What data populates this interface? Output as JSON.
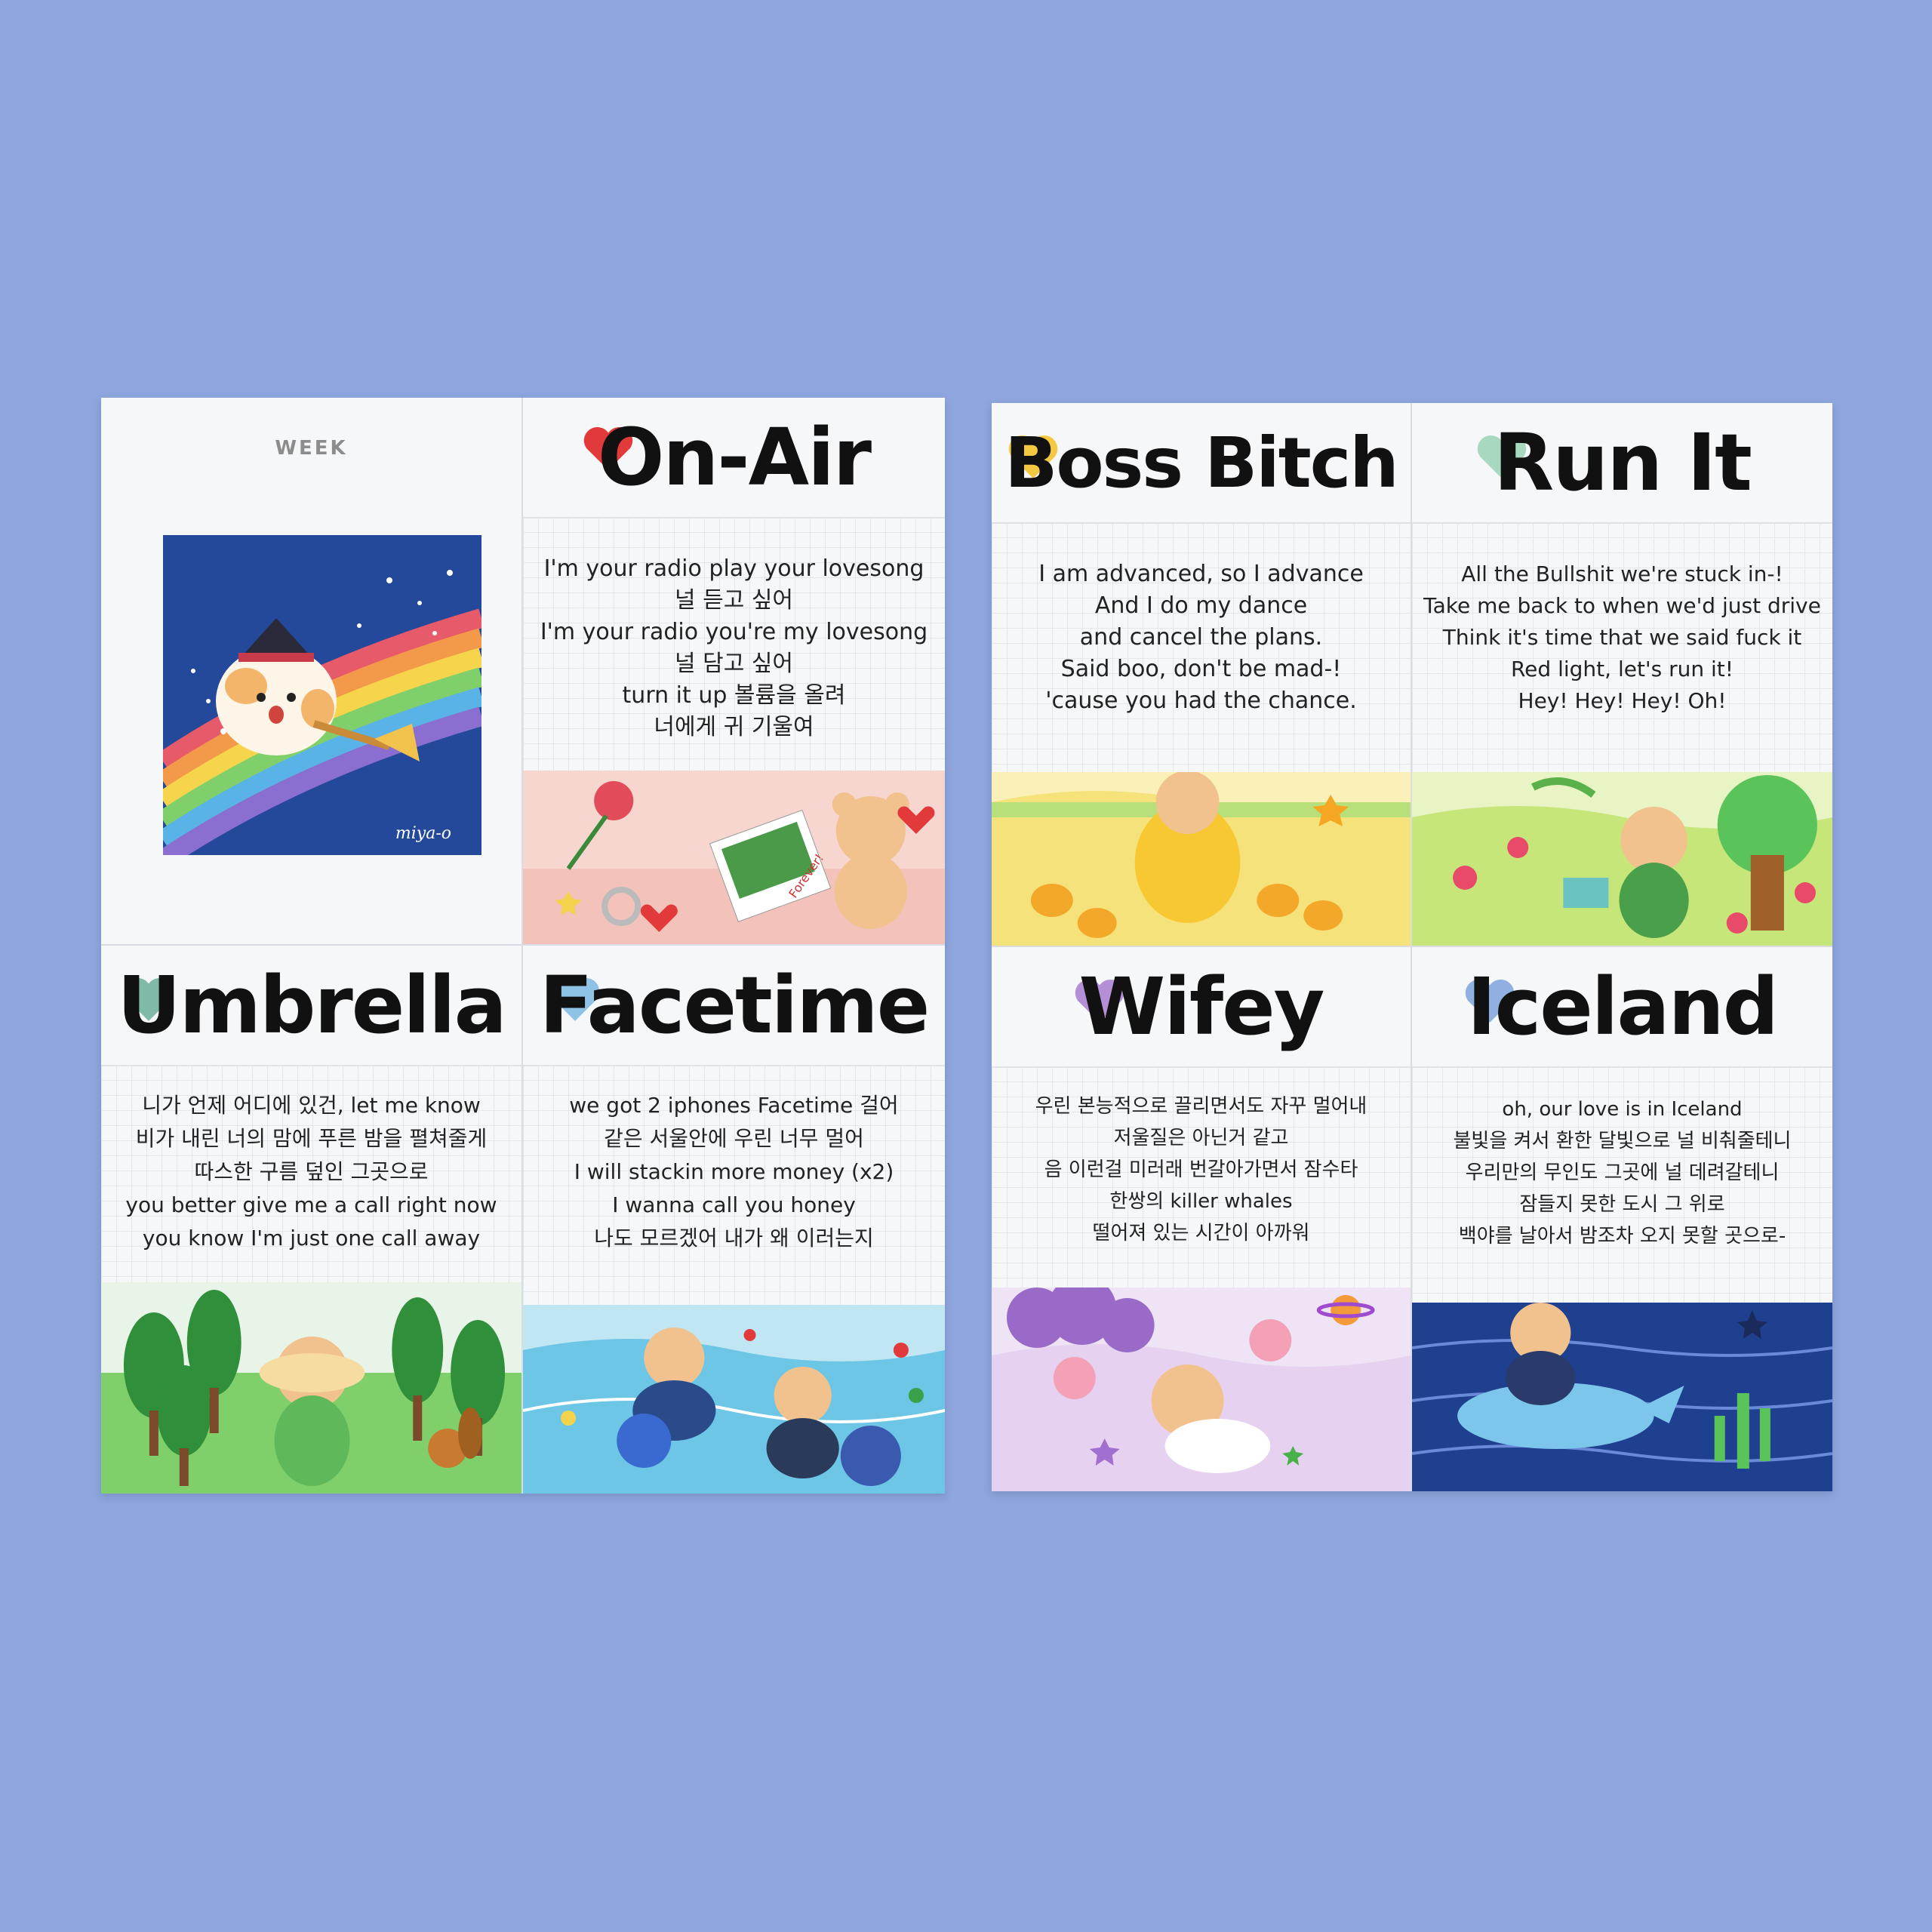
{
  "left_sheet": {
    "week_label": "WEEK",
    "cover_signature": "miya-o",
    "cards": [
      {
        "title": "On-Air",
        "heart_color": "#e23a3a",
        "lyrics": [
          "I'm your radio play your lovesong",
          "널 듣고 싶어",
          "I'm your radio you're my lovesong",
          "널 담고 싶어",
          "turn it up 볼륨을 올려",
          "너에게 귀 기울여"
        ],
        "sticker_text": "Forever!"
      },
      {
        "title": "Umbrella",
        "heart_color": "#7fb9a8",
        "lyrics": [
          "니가 언제 어디에 있건, let me know",
          "비가 내린 너의 맘에 푸른 밤을 펼쳐줄게",
          "따스한 구름 덮인 그곳으로",
          "you better give me a call right now",
          "you know I'm just one call away"
        ]
      },
      {
        "title": "Facetime",
        "heart_color": "#8fc3e6",
        "lyrics": [
          "we got 2 iphones Facetime 걸어",
          "같은 서울안에 우린 너무 멀어",
          "I will stackin more money (x2)",
          "I wanna call you honey",
          "나도 모르겠어 내가 왜 이러는지"
        ]
      }
    ]
  },
  "right_sheet": {
    "cards": [
      {
        "title": "Boss Bitch",
        "heart_color": "#f5c842",
        "lyrics": [
          "I am advanced, so I advance",
          "And I do my dance",
          "and cancel the plans.",
          "Said boo, don't be mad-!",
          "'cause you had the chance."
        ]
      },
      {
        "title": "Run It",
        "heart_color": "#a8d8c0",
        "lyrics": [
          "All the Bullshit we're stuck in-!",
          "Take me back to when we'd just drive",
          "Think it's time that we said fuck it",
          "Red light, let's run it!",
          "Hey! Hey! Hey! Oh!"
        ]
      },
      {
        "title": "Wifey",
        "heart_color": "#b48fd8",
        "lyrics": [
          "우린 본능적으로 끌리면서도 자꾸 멀어내",
          "저울질은 아닌거 같고",
          "음 이런걸 미러래 번갈아가면서 잠수타",
          "한쌍의 killer whales",
          "떨어져 있는 시간이 아까워"
        ]
      },
      {
        "title": "Iceland",
        "heart_color": "#8fb0e0",
        "lyrics": [
          "oh, our love is in Iceland",
          "불빛을 켜서 환한 달빛으로 널 비춰줄테니",
          "우리만의 무인도 그곳에 널 데려갈테니",
          "잠들지 못한 도시 그 위로",
          "백야를 날아서 밤조차 오지 못할 곳으로-"
        ]
      }
    ]
  },
  "colors": {
    "background": "#8ea6dd",
    "paper": "#f4f5f7",
    "ink": "#111111"
  }
}
